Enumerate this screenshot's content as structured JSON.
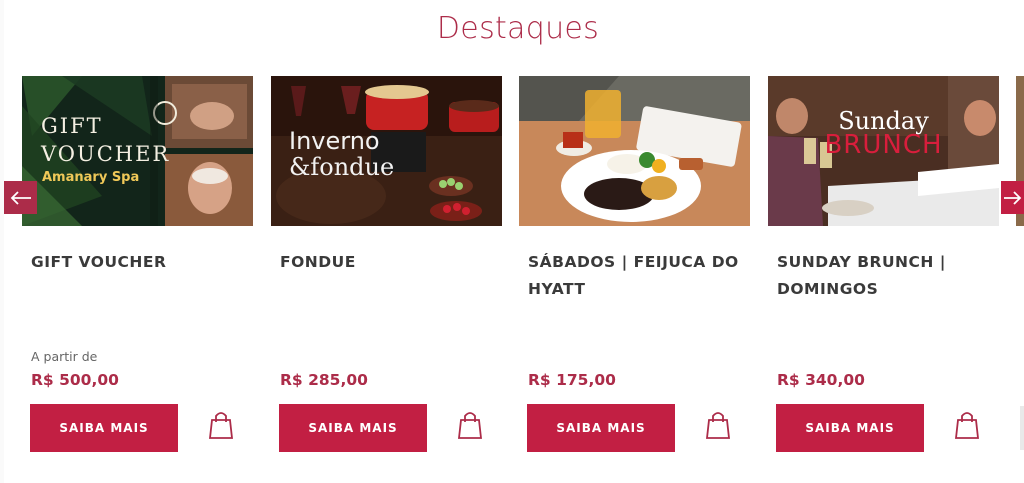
{
  "section": {
    "title": "Destaques"
  },
  "carousel": {
    "prev_icon": "arrow-left-icon",
    "next_icon": "arrow-right-icon",
    "items": [
      {
        "image_alt": "Gift voucher spa image",
        "image_text": {
          "line1": "GIFT",
          "line2": "VOUCHER",
          "line3": "Amanary Spa"
        },
        "title": "GIFT VOUCHER",
        "price_prefix": "A partir de",
        "price": "R$ 500,00",
        "cta": "SAIBA MAIS",
        "bag_icon": "shopping-bag-icon"
      },
      {
        "image_alt": "Inverno & fondue image",
        "image_text": {
          "line1": "Inverno",
          "line2": "&fondue"
        },
        "title": "FONDUE",
        "price_prefix": "",
        "price": "R$ 285,00",
        "cta": "SAIBA MAIS",
        "bag_icon": "shopping-bag-icon"
      },
      {
        "image_alt": "Feijoada plate image",
        "image_text": {},
        "title": "SÁBADOS | FEIJUCA DO HYATT",
        "price_prefix": "",
        "price": "R$ 175,00",
        "cta": "SAIBA MAIS",
        "bag_icon": "shopping-bag-icon"
      },
      {
        "image_alt": "Sunday brunch image",
        "image_text": {
          "line1": "Sunday",
          "line2": "BRUNCH"
        },
        "title": "SUNDAY BRUNCH | DOMINGOS",
        "price_prefix": "",
        "price": "R$ 340,00",
        "cta": "SAIBA MAIS",
        "bag_icon": "shopping-bag-icon"
      }
    ]
  },
  "colors": {
    "brand": "#ac2c49",
    "button": "#c21f43",
    "title_text": "#3a3a3a"
  }
}
